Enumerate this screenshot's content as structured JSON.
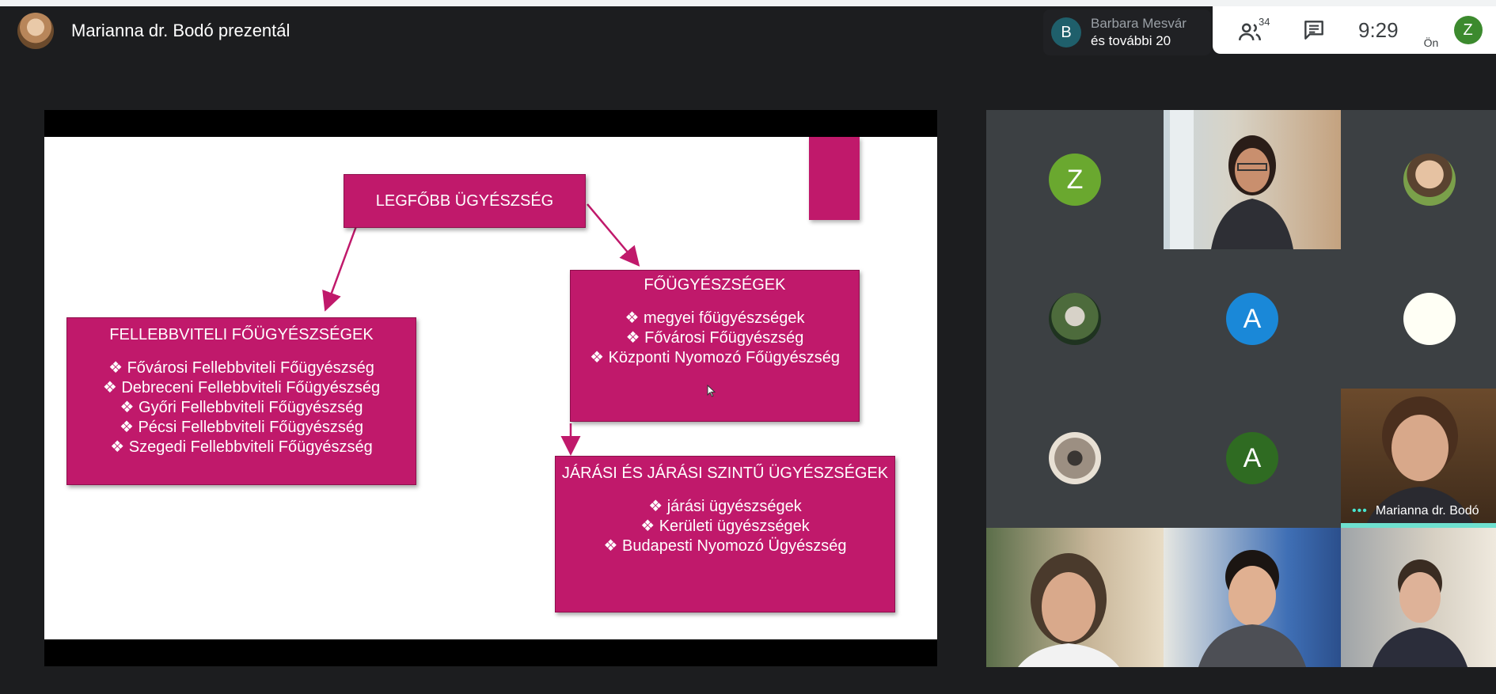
{
  "presenter": {
    "label": "Marianna dr. Bodó prezentál"
  },
  "contributors": {
    "avatar_letter": "B",
    "line1": "Barbara Mesvár",
    "line2": "és további 20"
  },
  "controls": {
    "participant_count": "34",
    "time": "9:29",
    "self_label": "Ön",
    "self_letter": "Z"
  },
  "slide": {
    "top": {
      "title": "LEGFŐBB ÜGYÉSZSÉG"
    },
    "left": {
      "title": "FELLEBBVITELI FŐÜGYÉSZSÉGEK",
      "items": [
        "Fővárosi Fellebbviteli Főügyészség",
        "Debreceni Fellebbviteli Főügyészség",
        "Győri Fellebbviteli Főügyészség",
        "Pécsi Fellebbviteli Főügyészség",
        "Szegedi Fellebbviteli Főügyészség"
      ]
    },
    "right": {
      "title": "FŐÜGYÉSZSÉGEK",
      "items": [
        "megyei főügyészségek",
        "Fővárosi Főügyészség",
        "Központi Nyomozó Főügyészség"
      ]
    },
    "bottom": {
      "title": "JÁRÁSI ÉS JÁRÁSI SZINTŰ ÜGYÉSZSÉGEK",
      "items": [
        "járási ügyészségek",
        "Kerületi ügyészségek",
        "Budapesti Nyomozó Ügyészség"
      ]
    }
  },
  "participants": {
    "tile1_letter": "Z",
    "tile5_letter": "A",
    "tile8_letter": "A",
    "speaker_name": "Marianna dr. Bodó"
  },
  "colors": {
    "accent": "#c0196b",
    "background": "#1c1d1f",
    "speaking": "#6ee0cf"
  }
}
